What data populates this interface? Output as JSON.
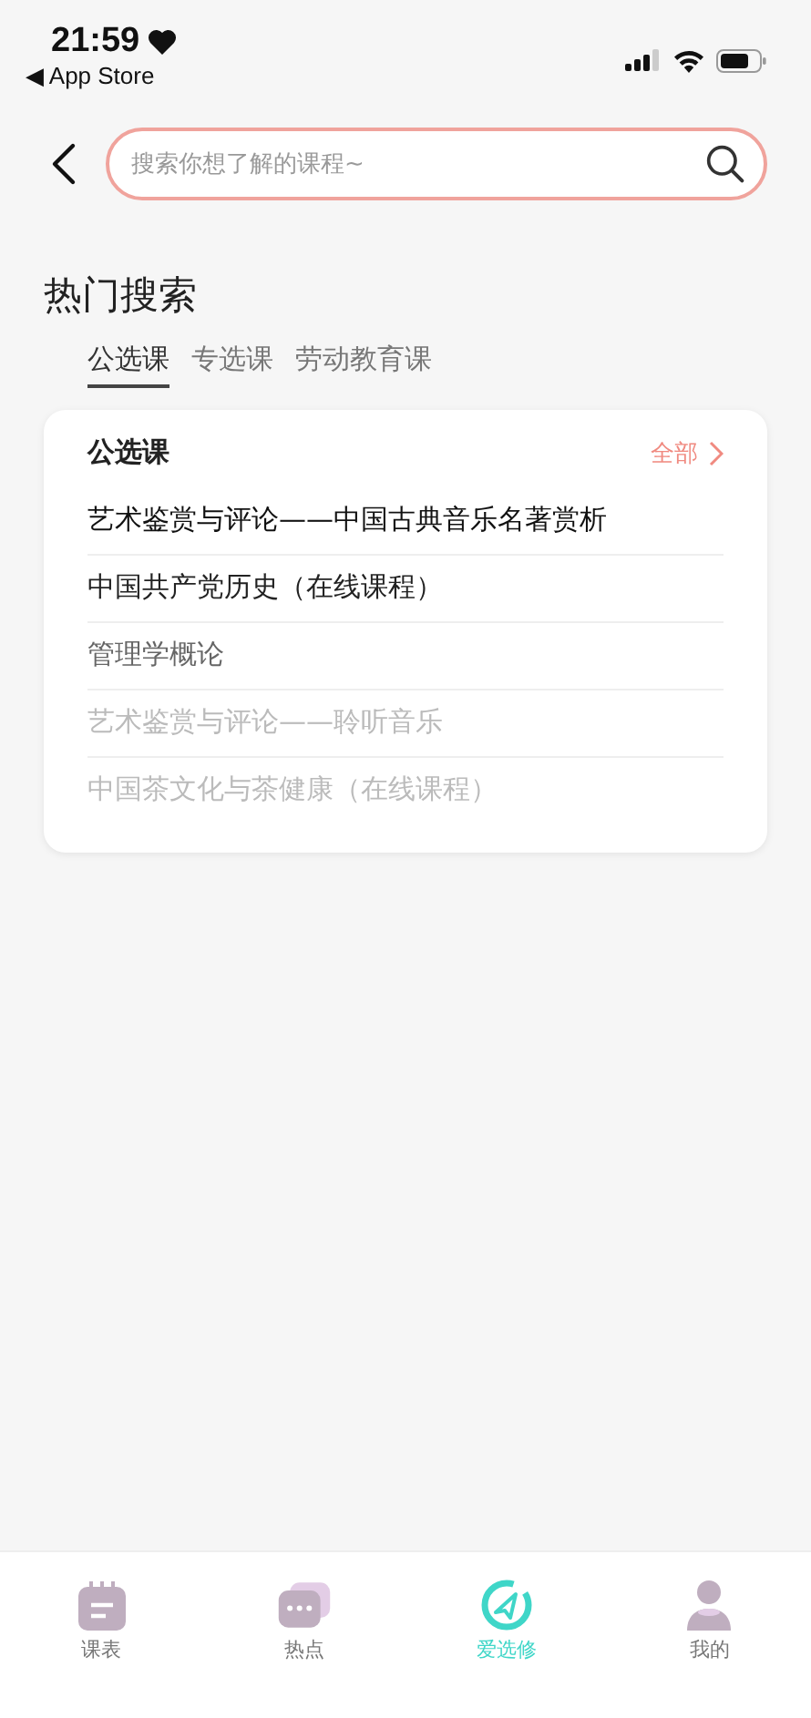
{
  "status_bar": {
    "time": "21:59",
    "back_label": "◀ App Store"
  },
  "search": {
    "placeholder": "搜索你想了解的课程~"
  },
  "section_title": "热门搜索",
  "tabs": [
    {
      "label": "公选课",
      "selected": true
    },
    {
      "label": "专选课",
      "selected": false
    },
    {
      "label": "劳动教育课",
      "selected": false
    }
  ],
  "card": {
    "title": "公选课",
    "more": "全部",
    "items": [
      {
        "label": "艺术鉴赏与评论——中国古典音乐名著赏析",
        "color": "#111111"
      },
      {
        "label": "中国共产党历史（在线课程）",
        "color": "#222222"
      },
      {
        "label": "管理学概论",
        "color": "#666666"
      },
      {
        "label": "艺术鉴赏与评论——聆听音乐",
        "color": "#bbbbbb"
      },
      {
        "label": "中国茶文化与茶健康（在线课程）",
        "color": "#bbbbbb"
      }
    ]
  },
  "tab_bar": [
    {
      "label": "课表",
      "kind": "calendar",
      "selected": false
    },
    {
      "label": "热点",
      "kind": "chat",
      "selected": false
    },
    {
      "label": "爱选修",
      "kind": "logo",
      "selected": true
    },
    {
      "label": "我的",
      "kind": "person",
      "selected": false
    }
  ]
}
